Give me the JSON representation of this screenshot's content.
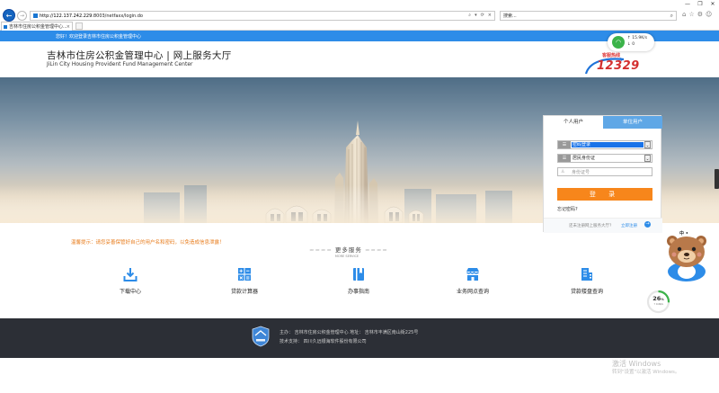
{
  "browser": {
    "url_host": "http://122.137.242.229",
    "url_path": ":8003/netfaxx/login.do",
    "address_tools": [
      "⌕",
      "▾",
      "⟳",
      "×"
    ],
    "search_placeholder": "搜索...",
    "tab_title": "吉林市住房公积金管理中心...",
    "tab_close": "×",
    "win_controls": [
      "—",
      "❐",
      "✕"
    ],
    "tool_icons": [
      "⌂",
      "☆",
      "⚙",
      "☺"
    ]
  },
  "welcome": {
    "text": "您好！欢迎登录吉林市住房公积金管理中心"
  },
  "header": {
    "title": "吉林市住房公积金管理中心 | 网上服务大厅",
    "subtitle": "JiLin City Housing Provident Fund Management Center",
    "hotline_label": "客服热线",
    "hotline_number": "12329"
  },
  "wifi_widget": {
    "icon": "wifi-icon",
    "speed_up": "↑ 15.9K/s",
    "speed_down": "↓ 0"
  },
  "login": {
    "tab_personal": "个人用户",
    "tab_unit": "单位用户",
    "select_login_type": "密码登录",
    "select_id_type": "居民身份证",
    "id_placeholder": "身份证号",
    "login_button": "登 录",
    "forgot_link": "忘记密码?",
    "register_text": "还未注册网上服务大厅?",
    "register_link": "立即注册",
    "register_arrow": "→",
    "colors": {
      "login_button": "#f7861b",
      "unit_tab": "#5fa7e6"
    }
  },
  "notice": {
    "warning": "温馨提示：请您妥善保管好自己的用户名和密码，以免造成信息泄露！"
  },
  "more_service": {
    "title": "更多服务",
    "subtitle": "MORE SERVICE",
    "items": [
      {
        "label": "下载中心",
        "icon": "download-icon"
      },
      {
        "label": "贷款计算器",
        "icon": "calculator-icon"
      },
      {
        "label": "办事指南",
        "icon": "guide-book-icon"
      },
      {
        "label": "业务网点查询",
        "icon": "branch-store-icon"
      },
      {
        "label": "贷款楼盘查询",
        "icon": "building-icon"
      }
    ]
  },
  "footer": {
    "line1": "主办： 吉林市住房公积金管理中心  地址： 吉林市丰满区南山街225号",
    "line2": "技术支持： 四川久远银海软件股份有限公司"
  },
  "floating": {
    "chat_label": "中 •",
    "progress_value": "26",
    "progress_unit": "%",
    "progress_sub": "↑ 0.0K/s"
  },
  "watermark": {
    "line1": "激活 Windows",
    "line2": "转到\"设置\"以激活 Windows。"
  }
}
